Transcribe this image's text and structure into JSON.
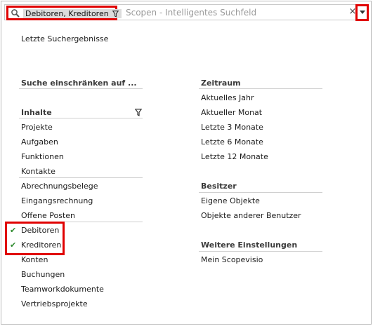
{
  "search": {
    "scope_label": "Debitoren, Kreditoren",
    "placeholder": "Scopen - Intelligentes Suchfeld",
    "clear_glyph": "×",
    "icons": {
      "search": "search-icon",
      "filter": "funnel-icon",
      "dropdown": "dropdown-arrow-icon"
    }
  },
  "recent": {
    "label": "Letzte Suchergebnisse"
  },
  "left": {
    "restrict_heading": "Suche einschränken auf ...",
    "contents_heading": "Inhalte",
    "groups": [
      [
        "Projekte",
        "Aufgaben",
        "Funktionen",
        "Kontakte"
      ],
      [
        "Abrechnungsbelege",
        "Eingangsrechnung",
        "Offene Posten"
      ],
      [
        "Debitoren",
        "Kreditoren",
        "Konten",
        "Buchungen",
        "Teamworkdokumente",
        "Vertriebsprojekte"
      ]
    ],
    "checked": [
      "Debitoren",
      "Kreditoren"
    ],
    "check_glyph": "✔"
  },
  "right": {
    "period_heading": "Zeitraum",
    "period_items": [
      "Aktuelles Jahr",
      "Aktueller Monat",
      "Letzte 3 Monate",
      "Letzte 6 Monate",
      "Letzte 12 Monate"
    ],
    "owner_heading": "Besitzer",
    "owner_items": [
      "Eigene Objekte",
      "Objekte anderer Benutzer"
    ],
    "more_heading": "Weitere Einstellungen",
    "more_items": [
      "Mein Scopevisio"
    ]
  },
  "colors": {
    "highlight": "#e00000",
    "check": "#2e8b2e",
    "chip": "#dcdcdc"
  }
}
